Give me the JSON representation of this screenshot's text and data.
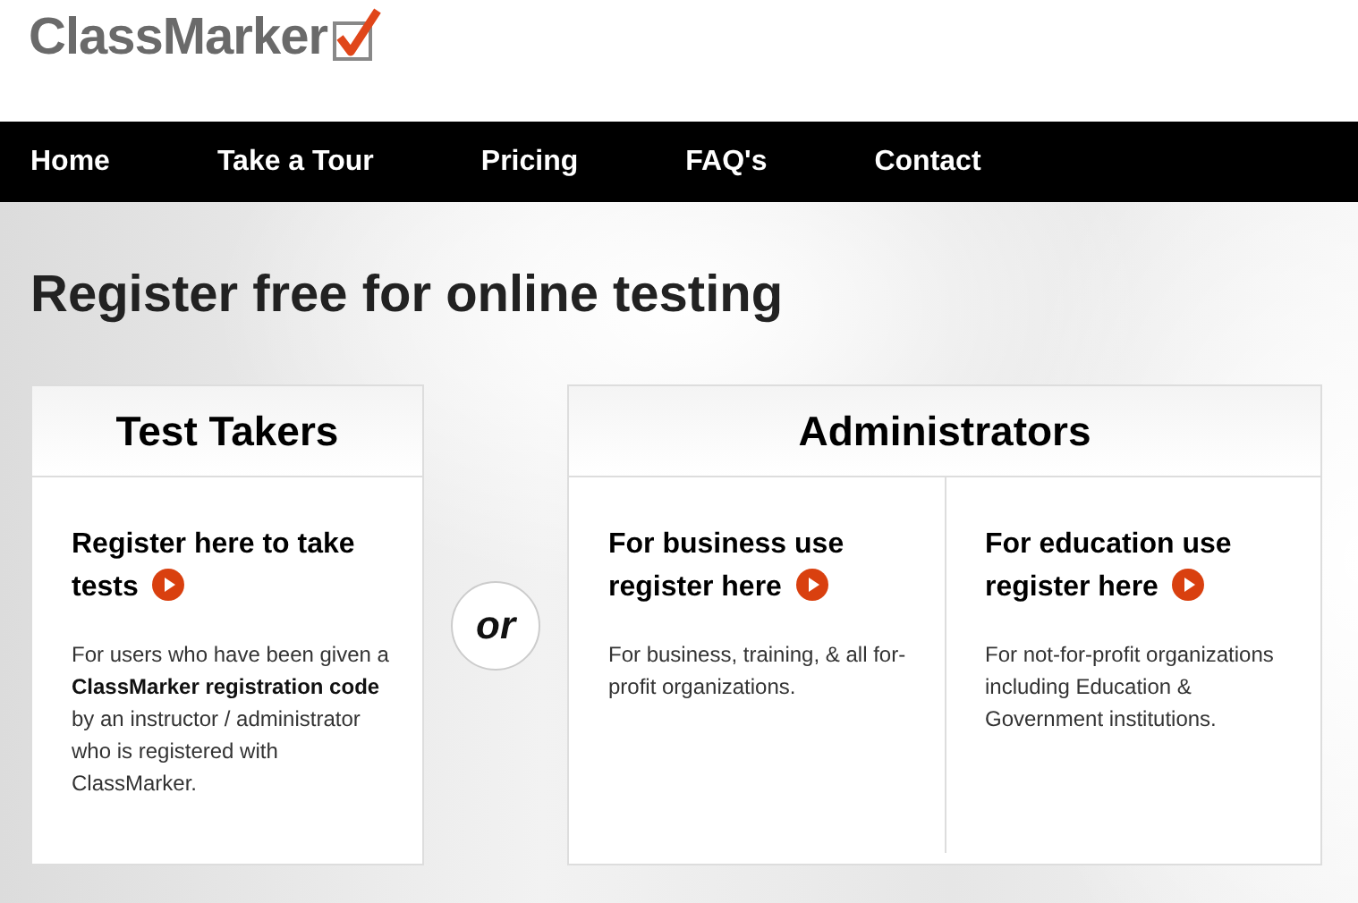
{
  "logo": {
    "text": "ClassMarker"
  },
  "nav": [
    "Home",
    "Take a Tour",
    "Pricing",
    "FAQ's",
    "Contact"
  ],
  "heading": "Register free for online testing",
  "test_takers": {
    "title": "Test Takers",
    "options": [
      {
        "link": "Register here to take tests",
        "description": "For users who have been given a **ClassMarker registration code** by an instructor / administrator who is registered with ClassMarker."
      }
    ]
  },
  "separator": "or",
  "administrators": {
    "title": "Administrators",
    "options": [
      {
        "link": "For business use register here",
        "description": "For business, training, & all for-profit organizations."
      },
      {
        "link": "For education use register here",
        "description": "For not-for-profit organizations including Education & Government institutions."
      }
    ]
  }
}
